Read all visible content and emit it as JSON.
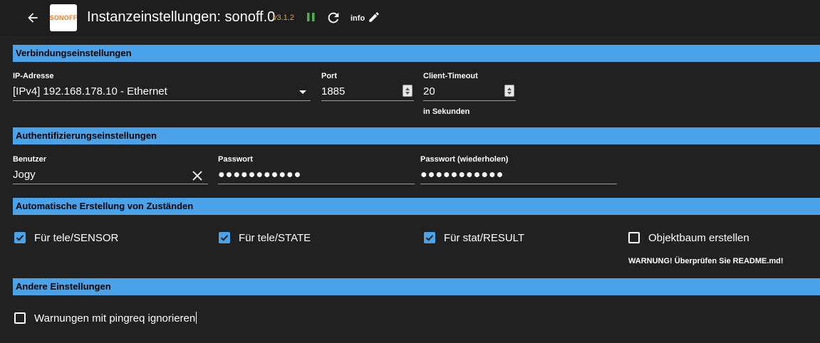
{
  "header": {
    "logo_text": "SONOFF",
    "title": "Instanzeinstellungen: sonoff.0",
    "version": "v3.1.2",
    "info_label": "info",
    "icons": [
      "arrow-back-icon",
      "pause-icon",
      "refresh-icon",
      "edit-pencil-icon"
    ],
    "colors": {
      "version": "#e0a23a",
      "pause": "#4caf50"
    }
  },
  "sections": {
    "connection": {
      "title": "Verbindungseinstellungen",
      "ip_label": "IP-Adresse",
      "ip_value": "[IPv4] 192.168.178.10 - Ethernet",
      "port_label": "Port",
      "port_value": "1885",
      "timeout_label": "Client-Timeout",
      "timeout_value": "20",
      "timeout_helper": "in Sekunden"
    },
    "auth": {
      "title": "Authentifizierungseinstellungen",
      "user_label": "Benutzer",
      "user_value": "Jogy",
      "password_label": "Passwort",
      "password_value": "●●●●●●●●●●●",
      "password_repeat_label": "Passwort (wiederholen)",
      "password_repeat_value": "●●●●●●●●●●●"
    },
    "auto_states": {
      "title": "Automatische Erstellung von Zuständen",
      "options": [
        {
          "label": "Für tele/SENSOR",
          "checked": true
        },
        {
          "label": "Für tele/STATE",
          "checked": true
        },
        {
          "label": "Für stat/RESULT",
          "checked": true
        },
        {
          "label": "Objektbaum erstellen",
          "checked": false
        }
      ],
      "warning": "WARNUNG! Überprüfen Sie README.md!"
    },
    "other": {
      "title": "Andere Einstellungen",
      "ignore_pingreq_label": "Warnungen mit pingreq ignorieren",
      "ignore_pingreq_checked": false
    }
  },
  "theme": {
    "accent": "#4aa3e8",
    "background": "#212121"
  }
}
